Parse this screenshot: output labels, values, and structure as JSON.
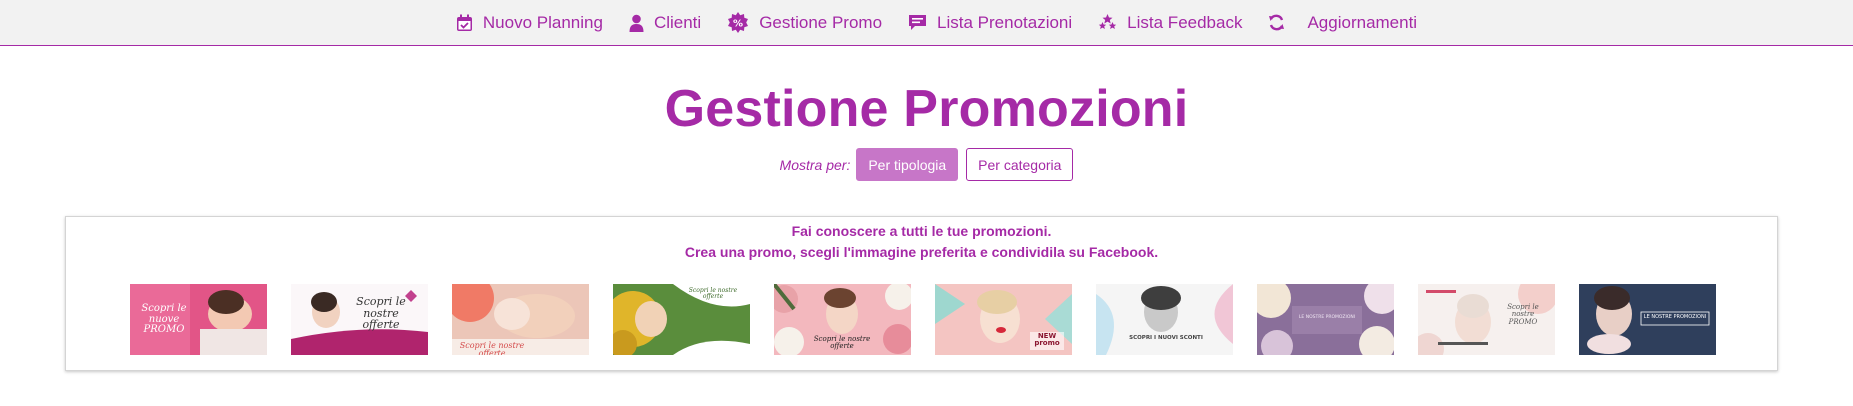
{
  "nav": {
    "items": [
      {
        "label": "Nuovo Planning",
        "icon": "calendar-check-icon"
      },
      {
        "label": "Clienti",
        "icon": "user-icon"
      },
      {
        "label": "Gestione Promo",
        "icon": "percent-badge-icon"
      },
      {
        "label": "Lista Prenotazioni",
        "icon": "comment-icon"
      },
      {
        "label": "Lista Feedback",
        "icon": "stars-icon"
      },
      {
        "label": "Aggiornamenti",
        "icon": "refresh-icon"
      }
    ],
    "accent": "#a52aa6"
  },
  "page": {
    "title": "Gestione Promozioni",
    "filter_label": "Mostra per:",
    "filter_active": "Per tipologia",
    "filter_other": "Per categoria"
  },
  "panel": {
    "line1": "Fai conoscere a tutti le tue promozioni.",
    "line2": "Crea una promo, scegli l'immagine preferita e condividila su Facebook."
  },
  "thumbnails": [
    {
      "text": "Scopri le nuove PROMO"
    },
    {
      "text": "Scopri le nostre offerte"
    },
    {
      "text": "Scopri le nostre offerte"
    },
    {
      "text": "Scopri le nostre offerte"
    },
    {
      "text": "Scopri le nostre offerte"
    },
    {
      "text": "NEW promo"
    },
    {
      "text": "SCOPRI I NUOVI SCONTI"
    },
    {
      "text": "LE NOSTRE PROMOZIONI"
    },
    {
      "text": "Scopri le nostre PROMO"
    },
    {
      "text": "LE NOSTRE PROMOZIONI"
    }
  ]
}
